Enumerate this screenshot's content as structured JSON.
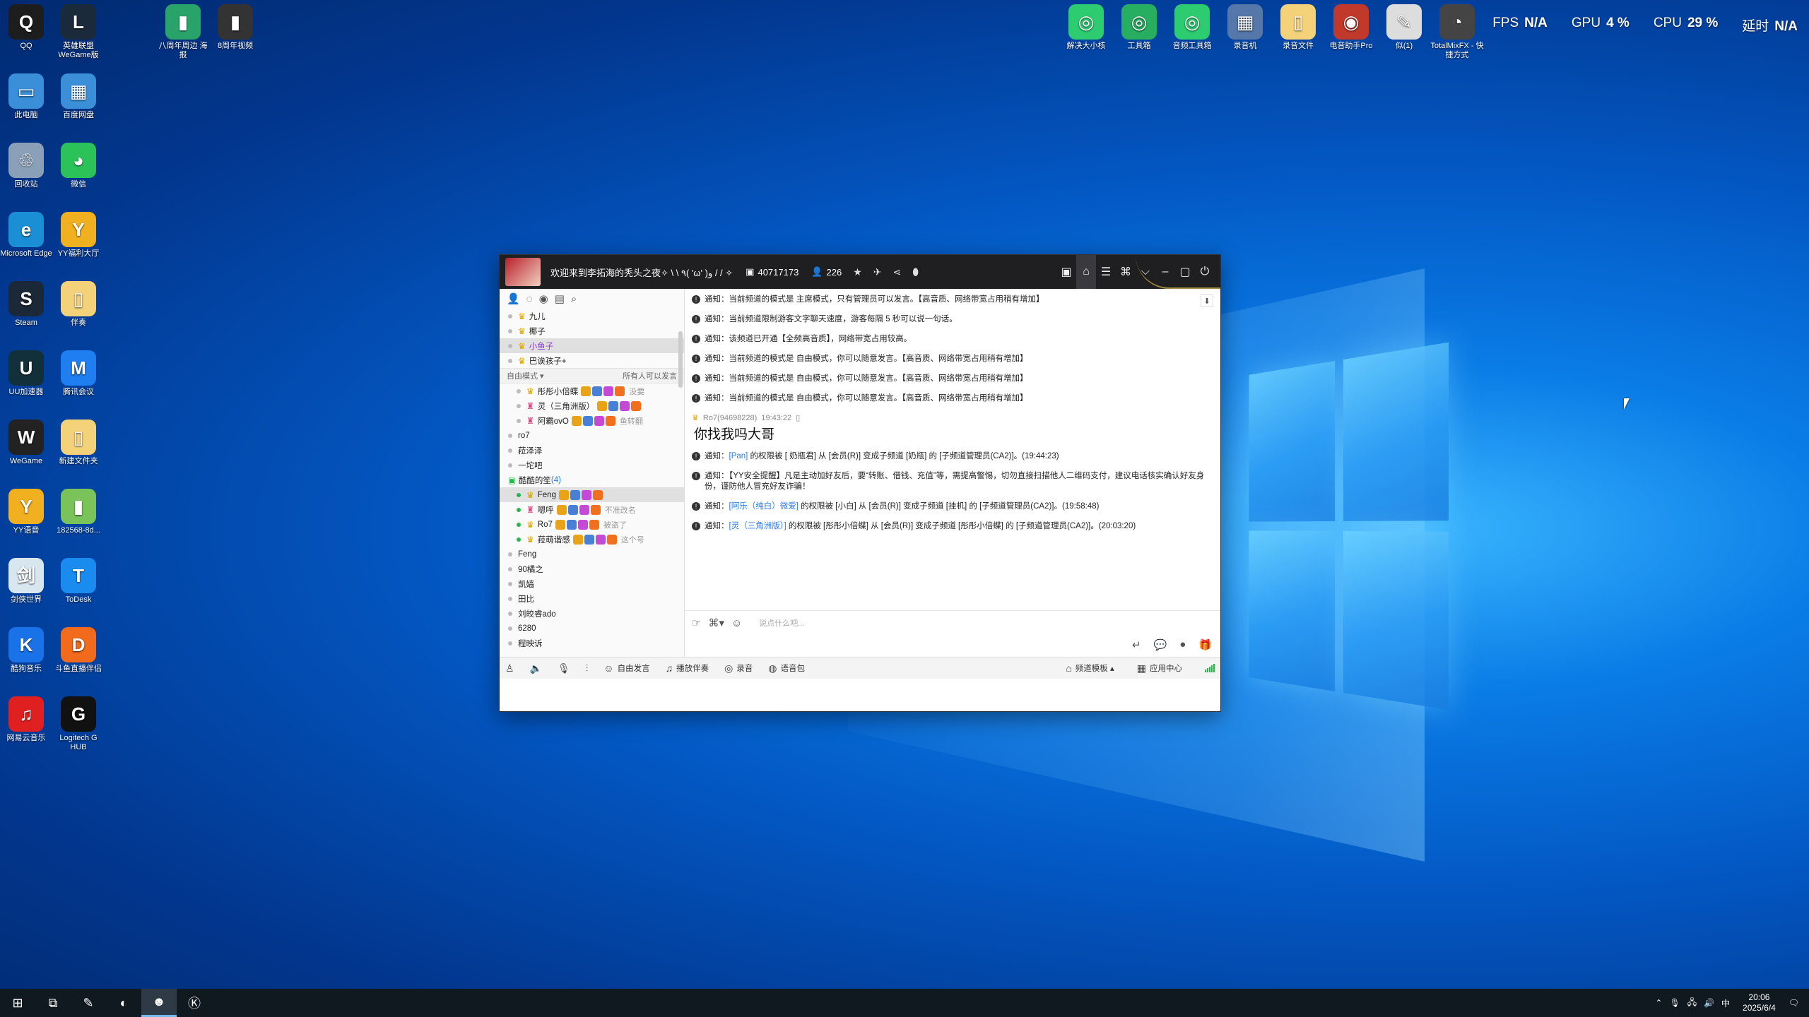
{
  "hud": {
    "fps_label": "FPS",
    "fps_value": "N/A",
    "gpu_label": "GPU",
    "gpu_value": "4 %",
    "cpu_label": "CPU",
    "cpu_value": "29 %",
    "lat_label": "延时",
    "lat_value": "N/A"
  },
  "desktop_icons": [
    {
      "label": "QQ",
      "glyph": "Q",
      "color": "#1d1d1d",
      "icon": "qq-icon"
    },
    {
      "label": "英雄联盟 WeGame版",
      "glyph": "L",
      "color": "#1a2a3a",
      "icon": "lol-icon"
    },
    {
      "label": "八周年周边 海报",
      "glyph": "▮",
      "color": "#2aa36b",
      "icon": "file-icon"
    },
    {
      "label": "8周年视频",
      "glyph": "▮",
      "color": "#333",
      "icon": "video-file-icon"
    },
    {
      "label": "此电脑",
      "glyph": "▭",
      "color": "#3a8fd8",
      "icon": "this-pc-icon"
    },
    {
      "label": "百度网盘",
      "glyph": "▦",
      "color": "#3a8fd8",
      "icon": "baidu-netdisk-icon"
    },
    {
      "label": "回收站",
      "glyph": "♲",
      "color": "#8aa0b8",
      "icon": "recycle-bin-icon"
    },
    {
      "label": "微信",
      "glyph": "◕",
      "color": "#2bc25a",
      "icon": "wechat-icon"
    },
    {
      "label": "Microsoft Edge",
      "glyph": "e",
      "color": "#1a8fd6",
      "icon": "edge-icon"
    },
    {
      "label": "YY福利大厅",
      "glyph": "Y",
      "color": "#f0b020",
      "icon": "yy-welfare-icon"
    },
    {
      "label": "Steam",
      "glyph": "S",
      "color": "#1b2838",
      "icon": "steam-icon"
    },
    {
      "label": "伴奏",
      "glyph": "▯",
      "color": "#f3d27a",
      "icon": "folder-icon"
    },
    {
      "label": "UU加速器",
      "glyph": "U",
      "color": "#12303a",
      "icon": "uu-icon"
    },
    {
      "label": "腾讯会议",
      "glyph": "M",
      "color": "#1f7ef0",
      "icon": "tencent-meeting-icon"
    },
    {
      "label": "WeGame",
      "glyph": "W",
      "color": "#222",
      "icon": "wegame-icon"
    },
    {
      "label": "新建文件夹",
      "glyph": "▯",
      "color": "#f3d27a",
      "icon": "folder-icon"
    },
    {
      "label": "YY语音",
      "glyph": "Y",
      "color": "#f0b020",
      "icon": "yy-icon"
    },
    {
      "label": "182568-8d...",
      "glyph": "▮",
      "color": "#7ac35a",
      "icon": "file-icon"
    },
    {
      "label": "剑侠世界",
      "glyph": "剑",
      "color": "#d8e6f0",
      "icon": "game-icon"
    },
    {
      "label": "ToDesk",
      "glyph": "T",
      "color": "#1a8cf0",
      "icon": "todesk-icon"
    },
    {
      "label": "酷狗音乐",
      "glyph": "K",
      "color": "#1a72e8",
      "icon": "kugou-icon"
    },
    {
      "label": "斗鱼直播伴侣",
      "glyph": "D",
      "color": "#f26a1b",
      "icon": "douyu-icon"
    },
    {
      "label": "网易云音乐",
      "glyph": "♫",
      "color": "#e02020",
      "icon": "netease-music-icon"
    },
    {
      "label": "Logitech G HUB",
      "glyph": "G",
      "color": "#111",
      "icon": "logitech-icon"
    }
  ],
  "top_icons": [
    {
      "label": "解决大小核",
      "glyph": "◎",
      "color": "#2ecc71",
      "icon": "core-fix-icon"
    },
    {
      "label": "工具箱",
      "glyph": "◎",
      "color": "#27ae60",
      "icon": "toolbox-icon"
    },
    {
      "label": "音频工具箱",
      "glyph": "◎",
      "color": "#2ecc71",
      "icon": "audio-toolbox-icon"
    },
    {
      "label": "录音机",
      "glyph": "▦",
      "color": "#5577aa",
      "icon": "recorder-icon"
    },
    {
      "label": "录音文件",
      "glyph": "▯",
      "color": "#f3d27a",
      "icon": "folder-icon"
    },
    {
      "label": "电音助手Pro",
      "glyph": "◉",
      "color": "#c0392b",
      "icon": "audio-helper-icon"
    },
    {
      "label": "似(1)",
      "glyph": "✎",
      "color": "#ddd",
      "icon": "file-icon"
    },
    {
      "label": "TotalMixFX - 快捷方式",
      "glyph": "◔",
      "color": "#444",
      "icon": "totalmix-icon"
    }
  ],
  "window": {
    "title": "欢迎来到李拓海的秃头之夜✧ \\ \\ ٩( 'ω' )و / / ✧",
    "room_id": "40717173",
    "online_count": "226"
  },
  "channel_tree": {
    "top_users": [
      {
        "name": "九儿",
        "selected": false
      },
      {
        "name": "椰子",
        "selected": false
      },
      {
        "name": "小鱼子",
        "selected": true
      },
      {
        "name": "巴诶孩子+",
        "selected": false
      }
    ],
    "mode_label": "自由模式 ▾",
    "mode_note": "所有人可以发言",
    "sub_users": [
      {
        "name": "彤彤小倍蝶",
        "note": "没要"
      },
      {
        "name": "灵（三角洲版）",
        "note": ""
      },
      {
        "name": "阿霸ovO",
        "note": "鱼转翻"
      }
    ],
    "channels_a": [
      "ro7",
      "菈泽泽",
      "一坨吧"
    ],
    "group_name": "酷酷的笙",
    "group_count": "(4)",
    "group_users": [
      {
        "name": "Feng",
        "note": "",
        "selected": true
      },
      {
        "name": "嗯呼",
        "note": "不准改名",
        "selected": false
      },
      {
        "name": "Ro7",
        "note": "被盗了",
        "selected": false
      },
      {
        "name": "菈萌谐感",
        "note": "这个号",
        "selected": false
      }
    ],
    "channels_b": [
      "Feng",
      "90橘之",
      "凯嫱",
      "田比",
      "刘皎睿ado",
      "6280",
      "程映诉"
    ]
  },
  "messages": [
    {
      "prefix": "通知：",
      "text": "当前频道的模式是 主席模式，只有管理员可以发言。【高音质、网络带宽占用稍有增加】"
    },
    {
      "prefix": "通知：",
      "text": "当前频道限制游客文字聊天速度，游客每隔 5 秒可以说一句话。"
    },
    {
      "prefix": "通知：",
      "text": "该频道已开通【全频高音质】，网络带宽占用较高。"
    },
    {
      "prefix": "通知：",
      "text": "当前频道的模式是 自由模式，你可以随意发言。【高音质、网络带宽占用稍有增加】"
    },
    {
      "prefix": "通知：",
      "text": "当前频道的模式是 自由模式，你可以随意发言。【高音质、网络带宽占用稍有增加】"
    },
    {
      "prefix": "通知：",
      "text": "当前频道的模式是 自由模式，你可以随意发言。【高音质、网络带宽占用稍有增加】"
    }
  ],
  "chat": {
    "sender": "Ro7(94698228)",
    "time": "19:43:22",
    "text": "你找我吗大哥"
  },
  "messages_after": [
    {
      "prefix": "通知：",
      "link": "[Pan]",
      "text": " 的权限被 [ 奶瓶君] 从 [会员(R)] 变成子频道 [奶瓶] 的 [子频道管理员(CA2)]。(19:44:23)"
    },
    {
      "prefix": "通知：",
      "link": "",
      "text": "【YY安全提醒】凡是主动加好友后，要“转账、借钱、充值”等，需提高警惕，切勿直接扫描他人二维码支付，建议电话核实确认好友身份，谨防他人冒充好友诈骗！"
    },
    {
      "prefix": "通知：",
      "link": "[阿乐（纯白）微爱]",
      "text": " 的权限被 [小白] 从 [会员(R)] 变成子频道 [挂机] 的 [子频道管理员(CA2)]。(19:58:48)"
    },
    {
      "prefix": "通知：",
      "link": "[灵（三角洲版）]",
      "text": " 的权限被 [彤彤小倍蝶] 从 [会员(R)] 变成子频道 [彤彤小倍蝶] 的 [子频道管理员(CA2)]。(20:03:20)"
    }
  ],
  "composer": {
    "placeholder": "说点什么吧..."
  },
  "bottombar": {
    "free_speak": "自由发言",
    "accompany": "播放伴奏",
    "record": "录音",
    "voice_pack": "语音包",
    "channel_template": "频道模板 ▴",
    "app_center": "应用中心"
  },
  "taskbar": {
    "ime": "中",
    "time": "20:06",
    "date": "2025/6/4"
  }
}
